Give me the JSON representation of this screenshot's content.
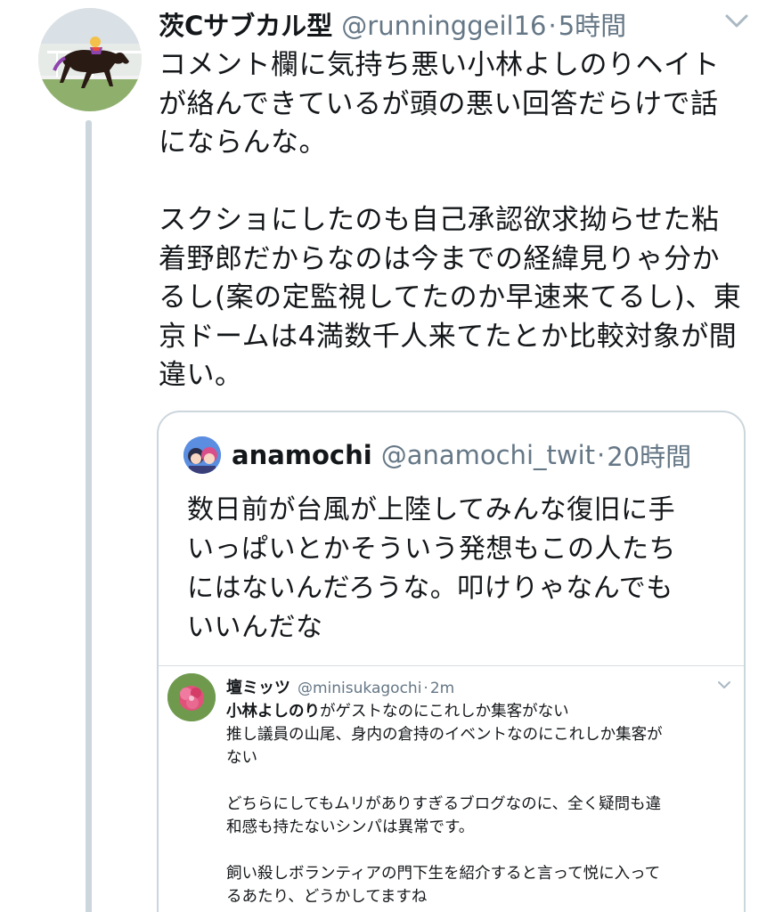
{
  "tweet": {
    "display_name": "茨Cサブカル型",
    "handle": "@runninggeil16",
    "separator": "·",
    "time": "5時間",
    "avatar_icon": "horse-racing-avatar",
    "text_lines": [
      "コメント欄に気持ち悪い小林よしのりヘイト",
      "が絡んできているが頭の悪い回答だらけで話",
      "にならんな。",
      "",
      "スクショにしたのも自己承認欲求拗らせた粘",
      "着野郎だからなのは今までの経緯見りゃ分か",
      "るし(案の定監視してたのか早速来てるし)、東",
      "京ドームは4満数千人来てたとか比較対象が間",
      "違い。"
    ]
  },
  "quote": {
    "display_name": "anamochi",
    "handle": "@anamochi_twit",
    "separator": "·",
    "time": "20時間",
    "text_lines": [
      "数日前が台風が上陸してみんな復旧に手",
      "いっぱいとかそういう発想もこの人たち",
      "にはないんだろうな。叩けりゃなんでも",
      "いいんだな"
    ],
    "embedded_screenshot": {
      "display_name": "壇ミッツ",
      "handle": "@minisukagochi",
      "separator": "·",
      "time": "2m",
      "line1_bold": "小林よしのり",
      "line1_rest": "がゲストなのにこれしか集客がない",
      "text_lines": [
        "推し議員の山尾、身内の倉持のイベントなのにこれしか集客が",
        "ない",
        "",
        "どちらにしてもムリがありすぎるブログなのに、全く疑問も違",
        "和感も持たないシンパは異常です。",
        "",
        "飼い殺しボランティアの門下生を紹介すると言って悦に入って",
        "るあたり、どうかしてますね"
      ]
    }
  },
  "colors": {
    "text": "#14171a",
    "secondary": "#657786",
    "border": "#ccd6dd"
  }
}
